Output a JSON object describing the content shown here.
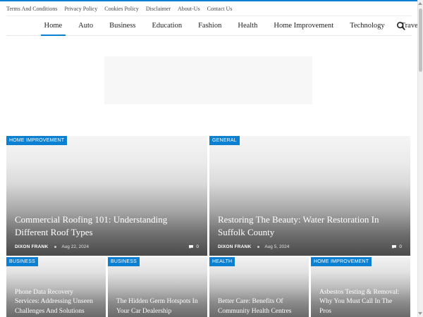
{
  "topbar": {
    "links": [
      "Terms And Conditions",
      "Privacy Policy",
      "Cookies Policy",
      "Disclaimer",
      "About-Us",
      "Contact Us"
    ]
  },
  "nav": {
    "items": [
      "Home",
      "Auto",
      "Business",
      "Education",
      "Fashion",
      "Health",
      "Home Improvement",
      "Technology",
      "Travel"
    ],
    "active": "Home"
  },
  "featured": [
    {
      "category": "HOME IMPROVEMENT",
      "title": "Commercial Roofing 101: Understanding Different Roof Types",
      "author": "DIXON FRANK",
      "date": "Aug 22, 2024",
      "comments": "0"
    },
    {
      "category": "GENERAL",
      "title": "Restoring The Beauty: Water Restoration In Suffolk County",
      "author": "DIXON FRANK",
      "date": "Aug 5, 2024",
      "comments": "0"
    }
  ],
  "small_cards": [
    {
      "category": "BUSINESS",
      "title": "Phone Data Recovery Services: Addressing Unseen Challenges And Solutions"
    },
    {
      "category": "BUSINESS",
      "title": "The Hidden Germ Hotspots In Your Car Dealership"
    },
    {
      "category": "HEALTH",
      "title": "Better Care: Benefits Of Community Health Centres"
    },
    {
      "category": "HOME IMPROVEMENT",
      "title": "Asbestos Testing & Removal: Why You Must Call In The Pros"
    }
  ],
  "colors": {
    "accent": "#0b7fd1"
  },
  "icons": {
    "search": "search-icon",
    "comment": "comment-icon"
  }
}
